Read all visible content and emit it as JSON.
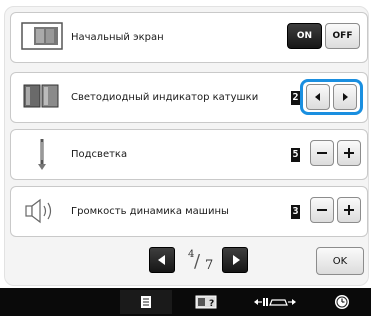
{
  "rows": [
    {
      "label": "Начальный экран",
      "icon": "home-screen-icon",
      "on_label": "ON",
      "off_label": "OFF",
      "selected": "ON"
    },
    {
      "label": "Светодиодный индикатор катушки",
      "icon": "bobbin-led-icon",
      "value": "2",
      "prev_icon": "arrow-left-icon",
      "next_icon": "arrow-right-icon"
    },
    {
      "label": "Подсветка",
      "icon": "needle-light-icon",
      "value": "5",
      "decrease_icon": "minus-icon",
      "increase_icon": "plus-icon"
    },
    {
      "label": "Громкость динамика машины",
      "icon": "speaker-icon",
      "value": "3",
      "decrease_icon": "minus-icon",
      "increase_icon": "plus-icon"
    }
  ],
  "pagination": {
    "current": "4",
    "total": "7",
    "prev_icon": "page-prev-icon",
    "next_icon": "page-next-icon"
  },
  "ok_label": "OK",
  "bottom_tabs": [
    {
      "icon": "page-icon",
      "selected": true
    },
    {
      "icon": "help-icon",
      "selected": false
    },
    {
      "icon": "width-adjust-icon",
      "selected": false
    },
    {
      "icon": "clock-icon",
      "selected": false
    }
  ],
  "colors": {
    "highlight": "#1a8fe0",
    "button_dark": "#1f1f1f",
    "bar": "#0a0a0a"
  }
}
